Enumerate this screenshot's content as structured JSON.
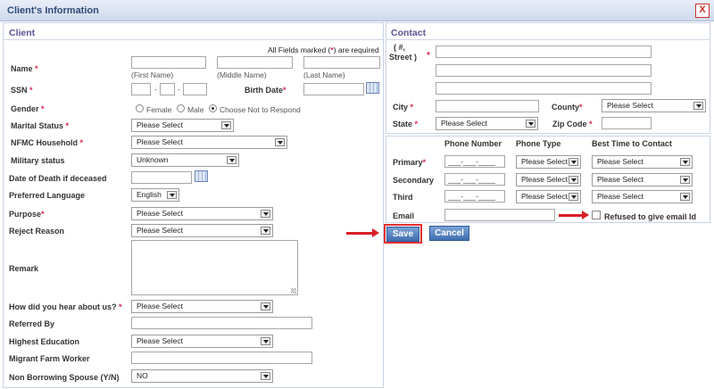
{
  "window": {
    "title": "Client's Information",
    "close_label": "X"
  },
  "client": {
    "section_title": "Client",
    "required_note_pre": "All Fields marked (",
    "required_note_star": "*",
    "required_note_post": ") are required",
    "name_label": "Name",
    "first_name_hint": "(First Name)",
    "middle_name_hint": "(Middle Name)",
    "last_name_hint": "(Last Name)",
    "ssn_label": "SSN",
    "ssn_sep": "-",
    "birth_date_label": "Birth Date",
    "gender_label": "Gender",
    "gender_options": [
      "Female",
      "Male",
      "Choose Not to Respond"
    ],
    "marital_status_label": "Marital Status",
    "marital_status_value": "Please Select",
    "nfmc_household_label": "NFMC Household",
    "nfmc_household_value": "Please Select",
    "military_status_label": "Military status",
    "military_status_value": "Unknown",
    "date_of_death_label": "Date of Death if deceased",
    "preferred_language_label": "Preferred Language",
    "preferred_language_value": "English",
    "purpose_label": "Purpose",
    "purpose_value": "Please Select",
    "reject_reason_label": "Reject Reason",
    "reject_reason_value": "Please Select",
    "remark_label": "Remark",
    "hear_about_label": "How did you hear about us?",
    "hear_about_value": "Please Select",
    "referred_by_label": "Referred By",
    "highest_education_label": "Highest Education",
    "highest_education_value": "Please Select",
    "migrant_farm_worker_label": "Migrant Farm Worker",
    "non_borrowing_spouse_label": "Non Borrowing Spouse (Y/N)",
    "non_borrowing_spouse_value": "NO"
  },
  "contact": {
    "section_title": "Contact",
    "street_label_1": "( #,",
    "street_label_2": "Street )",
    "city_label": "City",
    "county_label": "County",
    "county_value": "Please Select",
    "state_label": "State",
    "state_value": "Please Select",
    "zip_label": "Zip Code",
    "phone_header": "Phone Number",
    "phone_type_header": "Phone Type",
    "best_time_header": "Best Time to Contact",
    "rows": [
      {
        "label": "Primary",
        "required": true,
        "phone": "___-___-____",
        "type": "Please Select",
        "best_time": "Please Select"
      },
      {
        "label": "Secondary",
        "required": false,
        "phone": "___-___-____",
        "type": "Please Select",
        "best_time": "Please Select"
      },
      {
        "label": "Third",
        "required": false,
        "phone": "___-___-____",
        "type": "Please Select",
        "best_time": "Please Select"
      }
    ],
    "email_label": "Email",
    "refused_email_label": "Refused to give email Id"
  },
  "actions": {
    "save_label": "Save",
    "cancel_label": "Cancel"
  },
  "colors": {
    "accent": "#3f6fb0",
    "required": "#d9254a",
    "annotation": "#d91f26",
    "section_title": "#5e5393"
  }
}
